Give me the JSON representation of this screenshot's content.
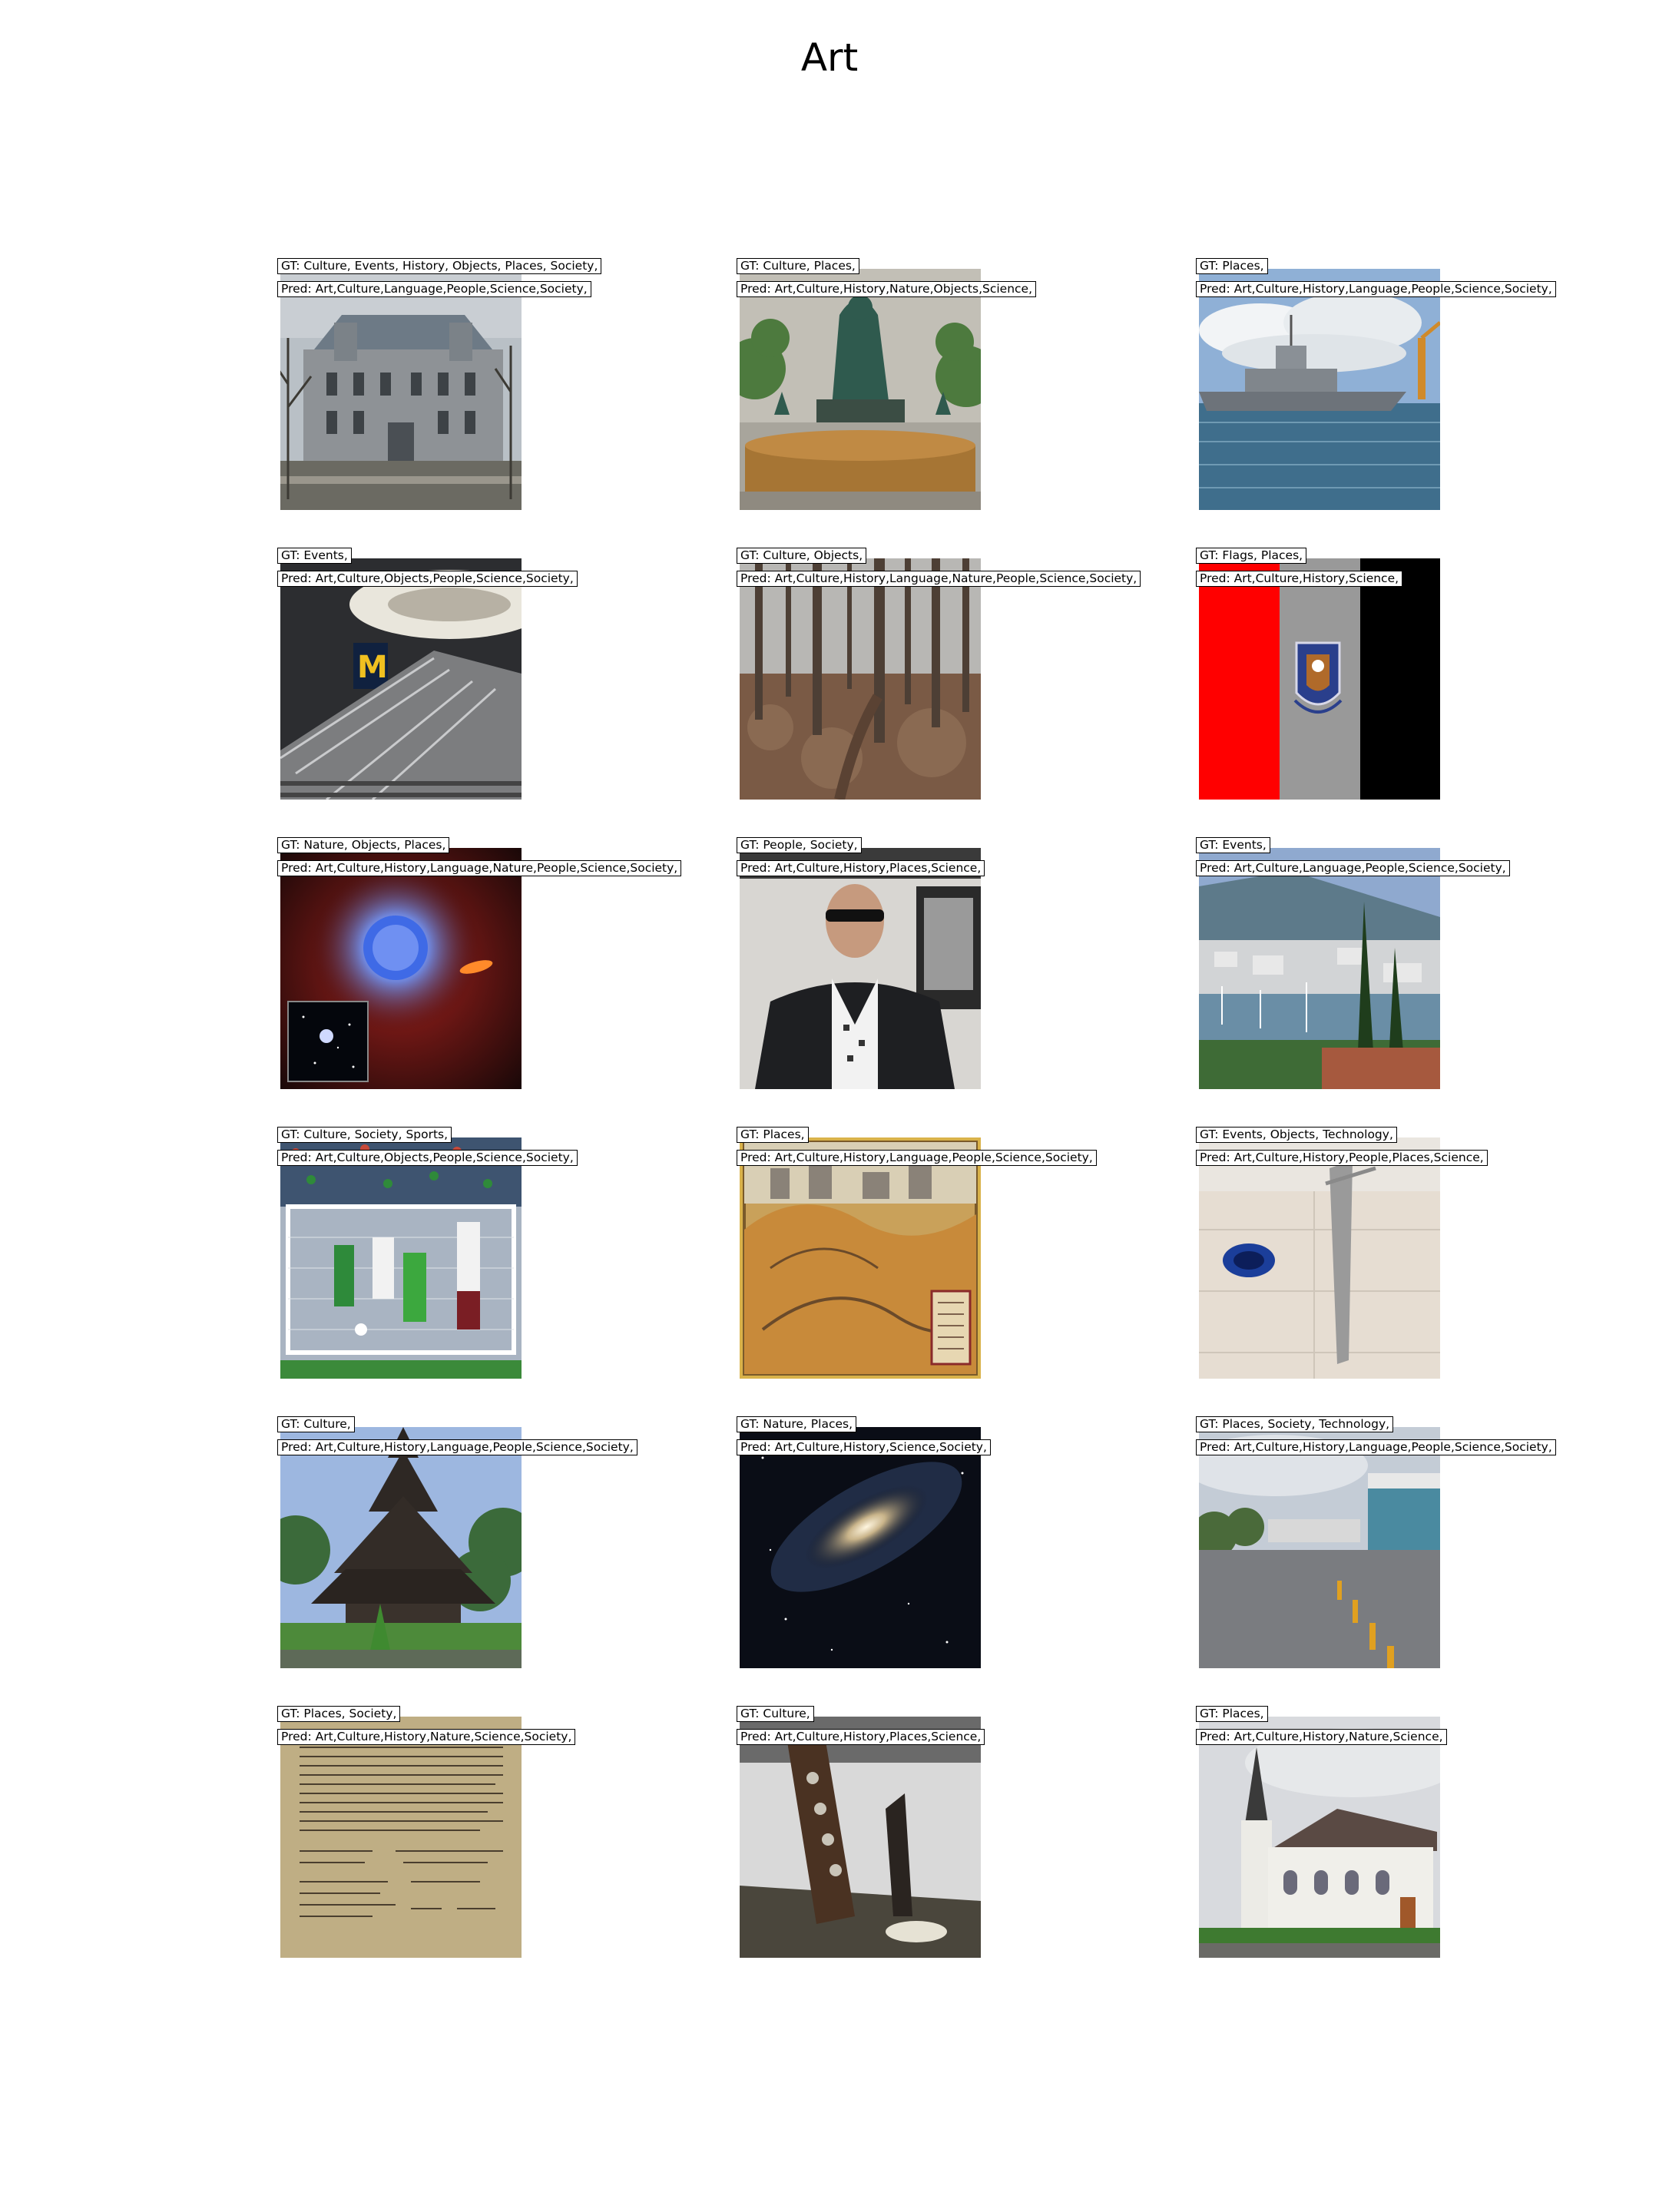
{
  "title": "Art",
  "items": [
    {
      "gt": "GT: Culture, Events, History, Objects, Places, Society,",
      "pred": "Pred: Art,Culture,Language,People,Science,Society,",
      "icon": "mansion-photo"
    },
    {
      "gt": "GT: Culture, Places,",
      "pred": "Pred: Art,Culture,History,Nature,Objects,Science,",
      "icon": "fountain-photo"
    },
    {
      "gt": "GT: Places,",
      "pred": "Pred: Art,Culture,History,Language,People,Science,Society,",
      "icon": "warship-photo"
    },
    {
      "gt": "GT: Events,",
      "pred": "Pred: Art,Culture,Objects,People,Science,Society,",
      "icon": "escalator-hall-photo"
    },
    {
      "gt": "GT: Culture, Objects,",
      "pred": "Pred: Art,Culture,History,Language,Nature,People,Science,Society,",
      "icon": "forest-photo"
    },
    {
      "gt": "GT: Flags, Places,",
      "pred": "Pred: Art,Culture,History,Science,",
      "icon": "flag-image"
    },
    {
      "gt": "GT: Nature, Objects, Places,",
      "pred": "Pred: Art,Culture,History,Language,Nature,People,Science,Society,",
      "icon": "star-illustration"
    },
    {
      "gt": "GT: People, Society,",
      "pred": "Pred: Art,Culture,History,Places,Science,",
      "icon": "man-portrait-photo"
    },
    {
      "gt": "GT: Events,",
      "pred": "Pred: Art,Culture,Language,People,Science,Society,",
      "icon": "harbor-photo"
    },
    {
      "gt": "GT: Culture, Society, Sports,",
      "pred": "Pred: Art,Culture,Objects,People,Science,Society,",
      "icon": "soccer-photo"
    },
    {
      "gt": "GT: Places,",
      "pred": "Pred: Art,Culture,History,Language,People,Science,Society,",
      "icon": "old-map-image"
    },
    {
      "gt": "GT: Events, Objects, Technology,",
      "pred": "Pred: Art,Culture,History,People,Places,Science,",
      "icon": "wall-fixture-photo"
    },
    {
      "gt": "GT: Culture,",
      "pred": "Pred: Art,Culture,History,Language,People,Science,Society,",
      "icon": "stave-church-photo"
    },
    {
      "gt": "GT: Nature, Places,",
      "pred": "Pred: Art,Culture,History,Science,Society,",
      "icon": "galaxy-photo"
    },
    {
      "gt": "GT: Places, Society, Technology,",
      "pred": "Pred: Art,Culture,History,Language,People,Science,Society,",
      "icon": "street-photo"
    },
    {
      "gt": "GT: Places, Society,",
      "pred": "Pred: Art,Culture,History,Nature,Science,Society,",
      "icon": "old-document-image"
    },
    {
      "gt": "GT: Culture,",
      "pred": "Pred: Art,Culture,History,Places,Science,",
      "icon": "wooden-tool-photo"
    },
    {
      "gt": "GT: Places,",
      "pred": "Pred: Art,Culture,History,Nature,Science,",
      "icon": "white-church-photo"
    }
  ]
}
